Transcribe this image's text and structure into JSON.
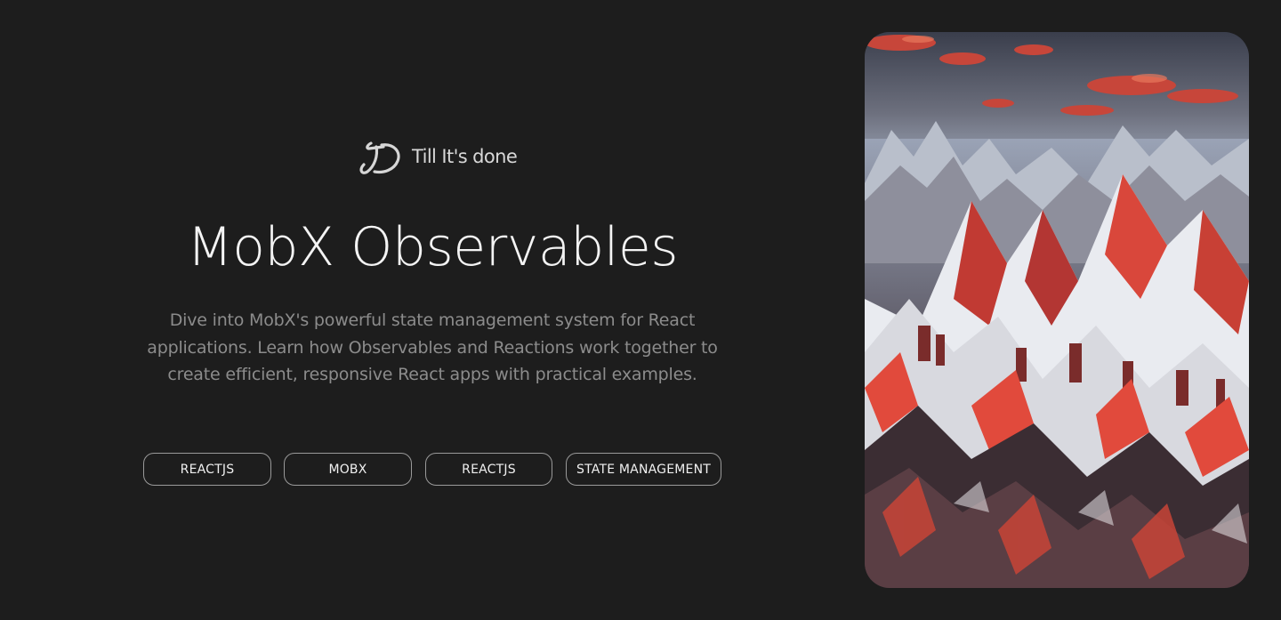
{
  "brand": {
    "logo_icon": "td-signature-logo-icon",
    "name": "Till It's done"
  },
  "hero": {
    "title": "MobX Observables",
    "description": "Dive into MobX's powerful state management system for React applications. Learn how Observables and Reactions work together to create efficient, responsive React apps with practical examples."
  },
  "tags": [
    "REACTJS",
    "MOBX",
    "REACTJS",
    "STATE MANAGEMENT"
  ],
  "cover_image": {
    "subject": "mountain-range-illustration"
  },
  "colors": {
    "background": "#1d1d1d",
    "title": "#f4f4f4",
    "description": "#8c8c8c",
    "tag_border": "#9a9a9a",
    "accent_red": "#e2473a"
  }
}
